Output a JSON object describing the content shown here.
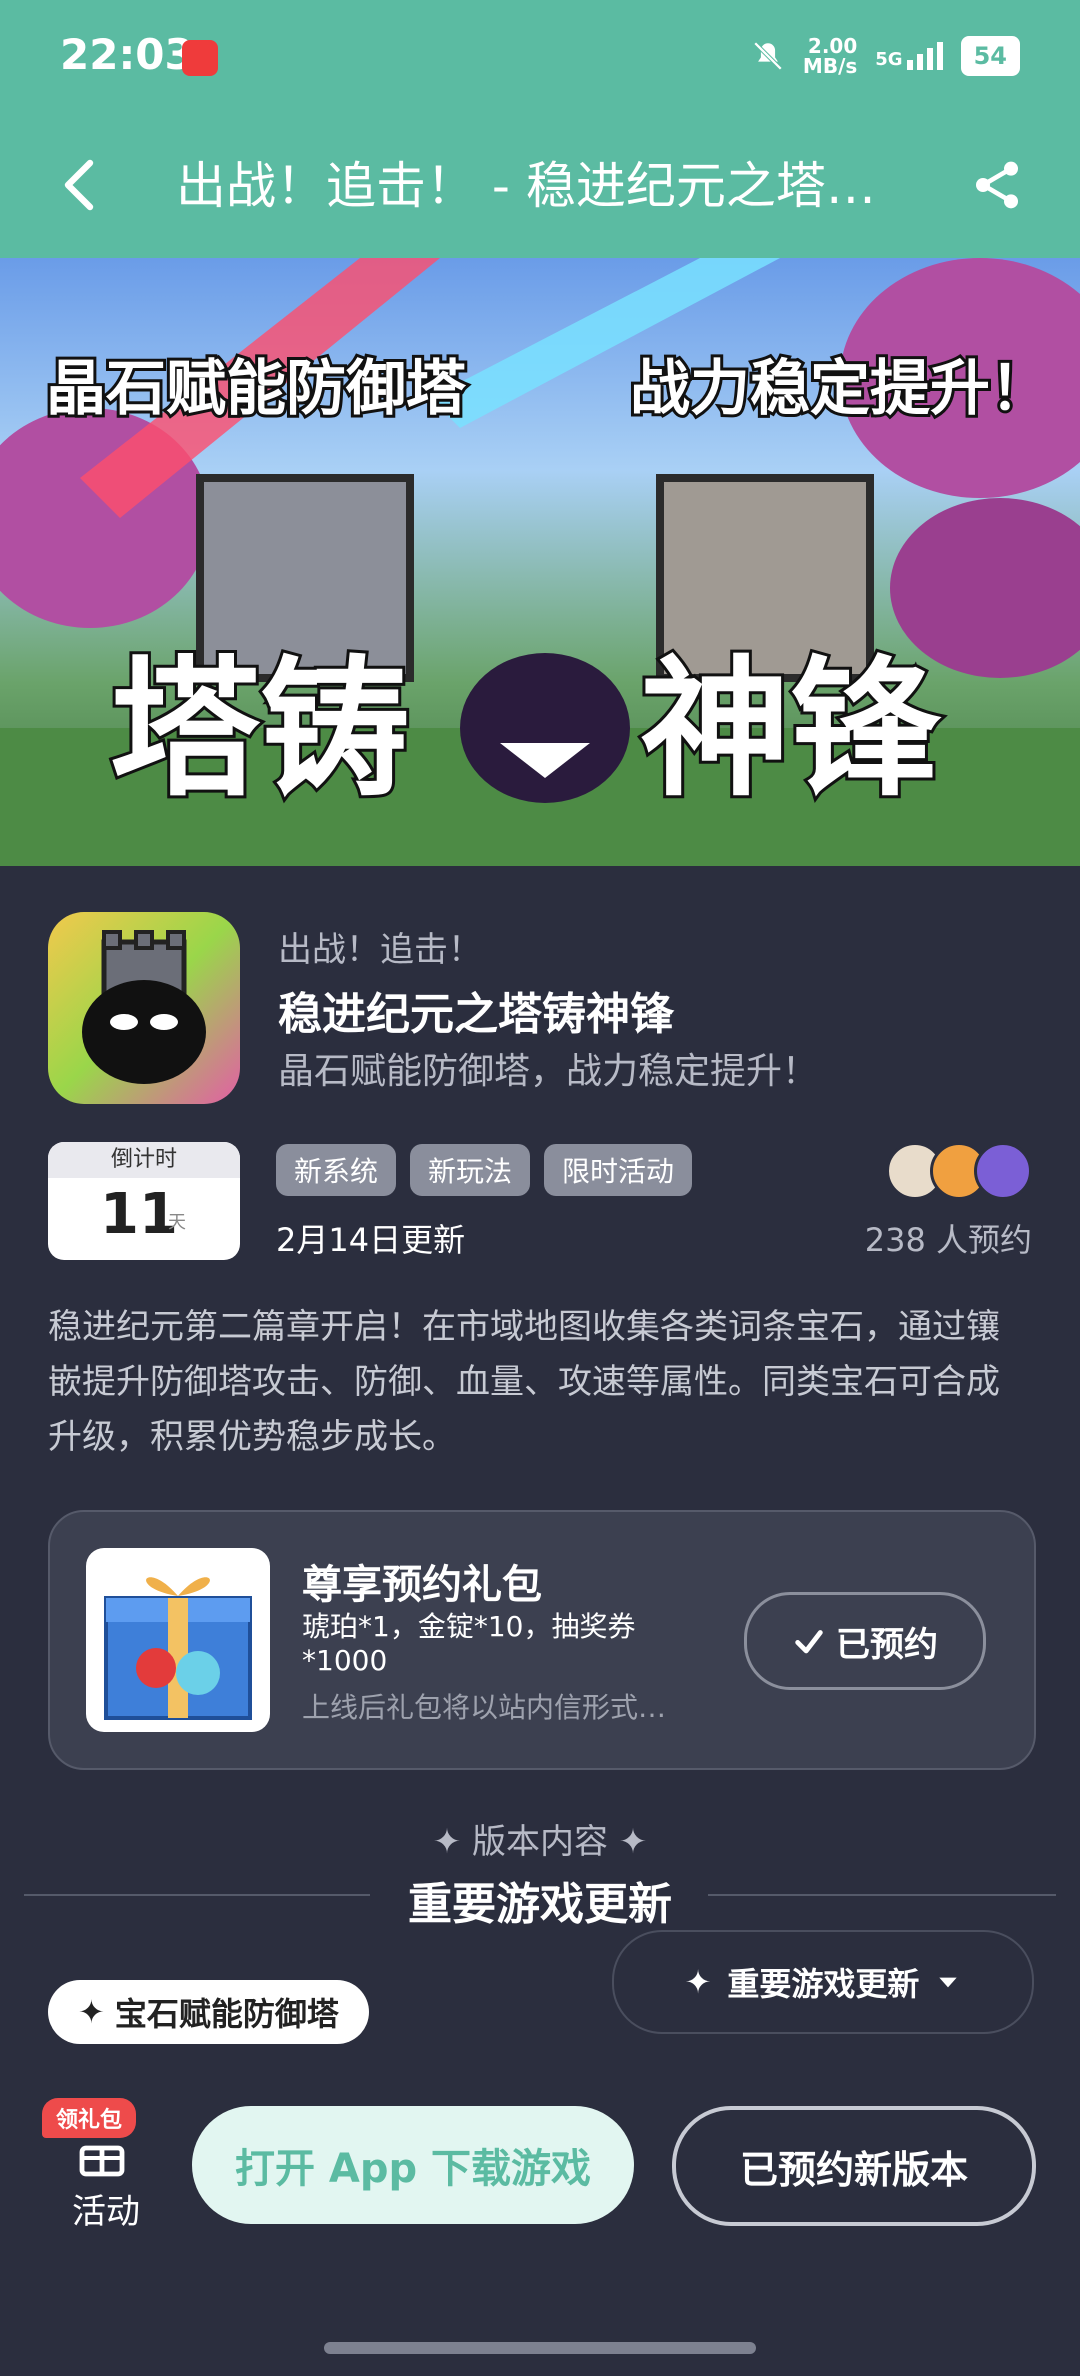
{
  "status_bar": {
    "time": "22:03",
    "network_speed_value": "2.00",
    "network_speed_unit": "MB/s",
    "network_type": "5G",
    "battery": "54"
  },
  "header": {
    "title": "出战！追击！ - 稳进纪元之塔…",
    "back_icon": "chevron-left-icon",
    "share_icon": "share-icon"
  },
  "banner": {
    "left_caption": "晶石赋能防御塔",
    "right_caption": "战力稳定提升！",
    "big_title_left": "塔铸",
    "big_title_right": "神锋"
  },
  "app": {
    "subtitle": "出战！追击！",
    "name": "稳进纪元之塔铸神锋",
    "tagline": "晶石赋能防御塔，战力稳定提升！"
  },
  "countdown": {
    "label": "倒计时",
    "value": "11",
    "unit": "天"
  },
  "tags": [
    "新系统",
    "新玩法",
    "限时活动"
  ],
  "update_date": "2月14日更新",
  "reserve_count": "238 人预约",
  "description": "稳进纪元第二篇章开启！在市域地图收集各类词条宝石，通过镶嵌提升防御塔攻击、防御、血量、攻速等属性。同类宝石可合成升级，积累优势稳步成长。",
  "gift": {
    "title": "尊享预约礼包",
    "items": "琥珀*1，金锭*10，抽奖券*1000",
    "note": "上线后礼包将以站内信形式…",
    "button": "已预约"
  },
  "section": {
    "label": "✦ 版本内容 ✦",
    "title": "重要游戏更新"
  },
  "version_select": {
    "selected": "重要游戏更新"
  },
  "feature_chip": "宝石赋能防御塔",
  "bottom_bar": {
    "activity_badge": "领礼包",
    "activity_label": "活动",
    "open_button": "打开 App 下载游戏",
    "new_version_button": "已预约新版本"
  },
  "colors": {
    "header_bg": "#5bbba2",
    "page_bg": "#2b2e3e",
    "badge_red": "#ee4b4b"
  }
}
